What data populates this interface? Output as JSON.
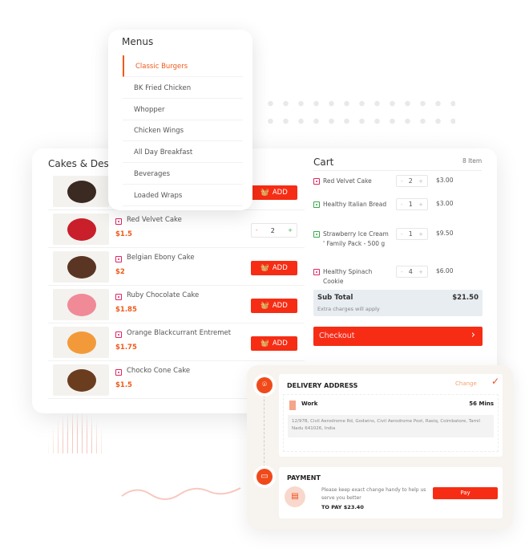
{
  "menus": {
    "title": "Menus",
    "items": [
      "Classic Burgers",
      "BK Fried Chicken",
      "Whopper",
      "Chicken Wings",
      "All Day Breakfast",
      "Beverages",
      "Loaded Wraps"
    ],
    "active_index": 0
  },
  "products": {
    "section_title": "Cakes & Desserts",
    "add_label": "ADD",
    "items": [
      {
        "name": "",
        "price": "",
        "state": "add"
      },
      {
        "name": "Red Velvet Cake",
        "price": "$1.5",
        "state": "qty",
        "qty": "2"
      },
      {
        "name": "Belgian Ebony Cake",
        "price": "$2",
        "state": "add"
      },
      {
        "name": "Ruby Chocolate Cake",
        "price": "$1.85",
        "state": "add"
      },
      {
        "name": "Orange Blackcurrant Entremet",
        "price": "$1.75",
        "state": "add"
      },
      {
        "name": "Chocko Cone Cake",
        "price": "$1.5",
        "state": "none"
      }
    ]
  },
  "cart": {
    "title": "Cart",
    "count": "8 Item",
    "items": [
      {
        "name": "Red Velvet Cake",
        "qty": "2",
        "price": "$3.00",
        "veg": false
      },
      {
        "name": "Healthy Italian Bread",
        "qty": "1",
        "price": "$3.00",
        "veg": true
      },
      {
        "name": "Strawberry Ice Cream ' Family Pack - 500 g",
        "qty": "1",
        "price": "$9.50",
        "veg": true
      },
      {
        "name": "Healthy Spinach Cookie",
        "qty": "4",
        "price": "$6.00",
        "veg": false
      }
    ],
    "subtotal_label": "Sub Total",
    "subtotal": "$21.50",
    "extra_note": "Extra charges will apply",
    "checkout_label": "Checkout"
  },
  "delivery": {
    "title": "DELIVERY ADDRESS",
    "change_label": "Change",
    "address_type": "Work",
    "eta": "56 Mins",
    "address": "12/97B, Civil Aerodrome Rd, Godwins, Civil Aerodrome Post, Rasiq, Coimbatore, Tamil Nadu 641026, India"
  },
  "payment": {
    "title": "PAYMENT",
    "note": "Please keep exact change handy to help us serve you better",
    "to_pay": "TO PAY $23.40",
    "pay_label": "Pay"
  },
  "colors": {
    "accent": "#f62d14",
    "price": "#f05a1a"
  }
}
